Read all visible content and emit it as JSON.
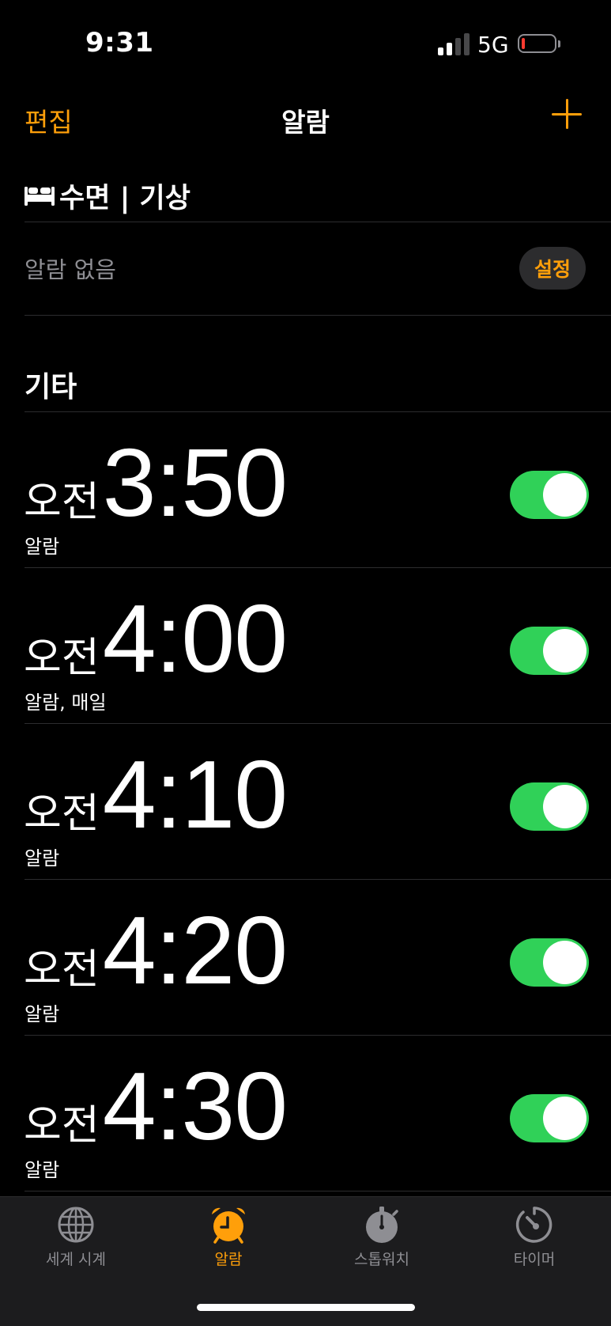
{
  "status_bar": {
    "time": "9:31",
    "network": "5G",
    "battery_level": 0.1,
    "battery_color": "#ff3b30",
    "signal_bars_active": 2,
    "signal_bars_total": 4
  },
  "nav": {
    "edit_label": "편집",
    "title": "알람",
    "add_icon": "plus-icon"
  },
  "sleep": {
    "icon": "bed-icon",
    "title": "수면 | 기상",
    "no_alarm": "알람 없음",
    "setup_label": "설정"
  },
  "other": {
    "title": "기타"
  },
  "alarms": [
    {
      "ampm": "오전",
      "time": "3:50",
      "label": "알람",
      "enabled": true
    },
    {
      "ampm": "오전",
      "time": "4:00",
      "label": "알람, 매일",
      "enabled": true
    },
    {
      "ampm": "오전",
      "time": "4:10",
      "label": "알람",
      "enabled": true
    },
    {
      "ampm": "오전",
      "time": "4:20",
      "label": "알람",
      "enabled": true
    },
    {
      "ampm": "오전",
      "time": "4:30",
      "label": "알람",
      "enabled": true
    }
  ],
  "tabs": [
    {
      "label": "세계 시계",
      "icon": "globe-icon",
      "active": false
    },
    {
      "label": "알람",
      "icon": "alarm-clock-icon",
      "active": true
    },
    {
      "label": "스톱워치",
      "icon": "stopwatch-icon",
      "active": false
    },
    {
      "label": "타이머",
      "icon": "timer-icon",
      "active": false
    }
  ],
  "colors": {
    "accent": "#ff9f0a",
    "toggle_on": "#30d158",
    "secondary_text": "#8e8e93",
    "background": "#000000"
  }
}
